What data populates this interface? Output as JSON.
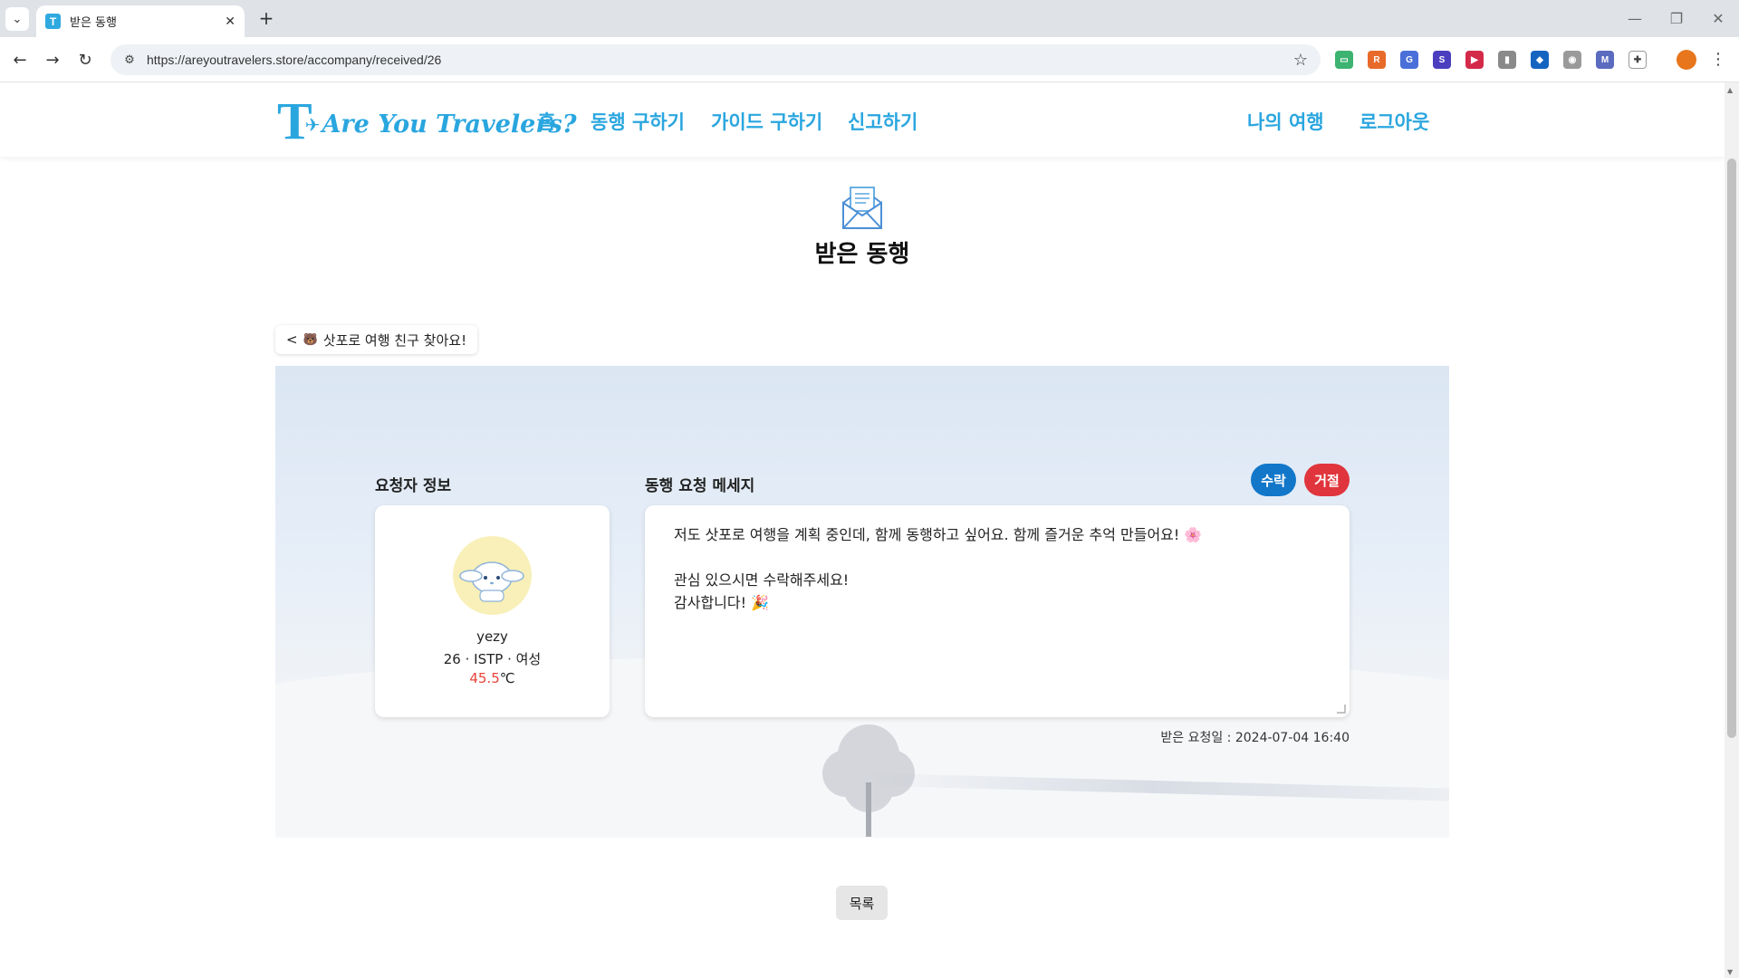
{
  "browser": {
    "tab_title": "받은 동행",
    "tab_favicon_letter": "T",
    "url": "https://areyoutravelers.store/accompany/received/26"
  },
  "site": {
    "brand_color": "#2aa6df",
    "logo_text": "Are You Travelers?",
    "nav": {
      "home": "홈",
      "find_companion": "동행 구하기",
      "find_guide": "가이드 구하기",
      "report": "신고하기",
      "my_trip": "나의 여행",
      "logout": "로그아웃"
    }
  },
  "page": {
    "title": "받은 동행",
    "back_post_title": "삿포로 여행 친구 찾아요!",
    "back_prefix": "<",
    "requester_section_label": "요청자 정보",
    "message_section_label": "동행 요청 메세지",
    "requester": {
      "name": "yezy",
      "meta": "26 · ISTP · 여성",
      "temperature_value": "45.5",
      "temperature_unit": "℃"
    },
    "message": {
      "line1": "저도 삿포로 여행을 계획 중인데, 함께 동행하고 싶어요. 함께 즐거운 추억 만들어요! 🌸",
      "line2": "",
      "line3": "관심 있으시면 수락해주세요!",
      "line4": "감사합니다! 🎉"
    },
    "accept_label": "수락",
    "reject_label": "거절",
    "received_date": "받은 요청일 : 2024-07-04 16:40",
    "list_button_label": "목록",
    "accept_color": "#1277c9",
    "reject_color": "#e0353c"
  }
}
